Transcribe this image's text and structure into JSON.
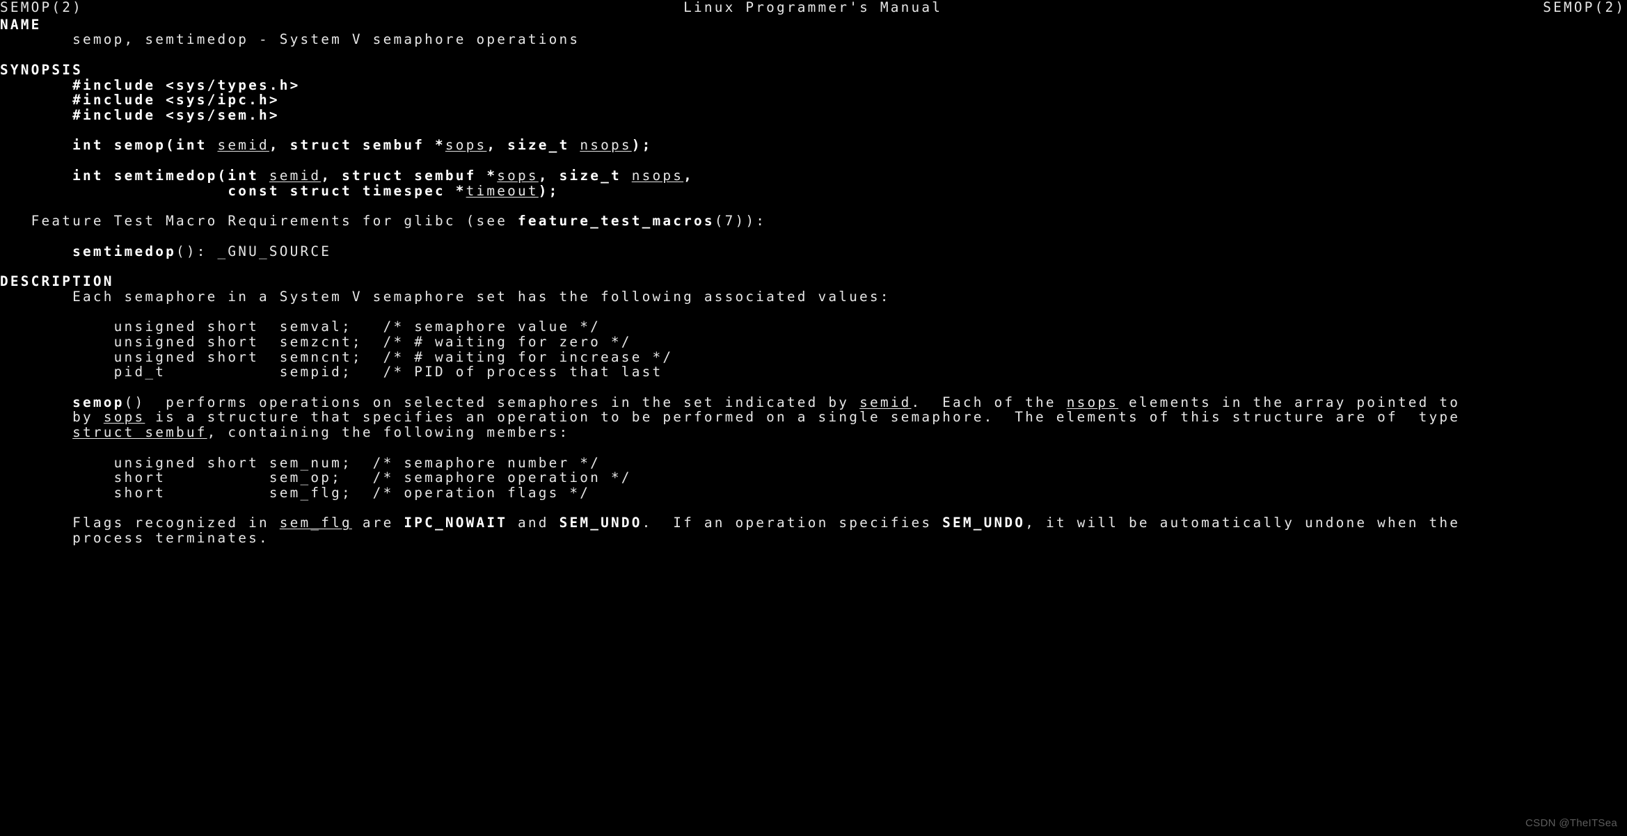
{
  "terminal": {
    "background_color": "#000000",
    "foreground_color": "#e6e6e6",
    "bold_color": "#ffffff"
  },
  "manpage": {
    "name": "SEMOP",
    "section": "2",
    "header_left": "SEMOP(2)",
    "header_center": "Linux Programmer's Manual",
    "header_right": "SEMOP(2)"
  },
  "lines": [
    {
      "id": "blank-1",
      "segments": []
    },
    {
      "id": "section-name",
      "segments": [
        {
          "t": "NAME",
          "s": "b"
        }
      ]
    },
    {
      "id": "name-body",
      "segments": [
        {
          "t": "       semop, semtimedop - System V semaphore operations",
          "s": ""
        }
      ]
    },
    {
      "id": "blank-2",
      "segments": []
    },
    {
      "id": "section-synopsis",
      "segments": [
        {
          "t": "SYNOPSIS",
          "s": "b"
        }
      ]
    },
    {
      "id": "include-types",
      "segments": [
        {
          "t": "       ",
          "s": ""
        },
        {
          "t": "#include <sys/types.h>",
          "s": "b"
        }
      ]
    },
    {
      "id": "include-ipc",
      "segments": [
        {
          "t": "       ",
          "s": ""
        },
        {
          "t": "#include <sys/ipc.h>",
          "s": "b"
        }
      ]
    },
    {
      "id": "include-sem",
      "segments": [
        {
          "t": "       ",
          "s": ""
        },
        {
          "t": "#include <sys/sem.h>",
          "s": "b"
        }
      ]
    },
    {
      "id": "blank-3",
      "segments": []
    },
    {
      "id": "proto-semop",
      "segments": [
        {
          "t": "       ",
          "s": ""
        },
        {
          "t": "int semop(int ",
          "s": "b"
        },
        {
          "t": "semid",
          "s": "u"
        },
        {
          "t": ", struct sembuf *",
          "s": "b"
        },
        {
          "t": "sops",
          "s": "u"
        },
        {
          "t": ", size_t ",
          "s": "b"
        },
        {
          "t": "nsops",
          "s": "u"
        },
        {
          "t": ");",
          "s": "b"
        }
      ]
    },
    {
      "id": "blank-4",
      "segments": []
    },
    {
      "id": "proto-semtimedop-1",
      "segments": [
        {
          "t": "       ",
          "s": ""
        },
        {
          "t": "int semtimedop(int ",
          "s": "b"
        },
        {
          "t": "semid",
          "s": "u"
        },
        {
          "t": ", struct sembuf *",
          "s": "b"
        },
        {
          "t": "sops",
          "s": "u"
        },
        {
          "t": ", size_t ",
          "s": "b"
        },
        {
          "t": "nsops",
          "s": "u"
        },
        {
          "t": ",",
          "s": "b"
        }
      ]
    },
    {
      "id": "proto-semtimedop-2",
      "segments": [
        {
          "t": "                      ",
          "s": ""
        },
        {
          "t": "const struct timespec *",
          "s": "b"
        },
        {
          "t": "timeout",
          "s": "u"
        },
        {
          "t": ");",
          "s": "b"
        }
      ]
    },
    {
      "id": "blank-5",
      "segments": []
    },
    {
      "id": "feature-test-heading",
      "segments": [
        {
          "t": "   Feature Test Macro Requirements for glibc (see ",
          "s": ""
        },
        {
          "t": "feature_test_macros",
          "s": "b"
        },
        {
          "t": "(7)):",
          "s": ""
        }
      ]
    },
    {
      "id": "blank-6",
      "segments": []
    },
    {
      "id": "feature-test-semtimedop",
      "segments": [
        {
          "t": "       ",
          "s": ""
        },
        {
          "t": "semtimedop",
          "s": "b"
        },
        {
          "t": "(): _GNU_SOURCE",
          "s": ""
        }
      ]
    },
    {
      "id": "blank-7",
      "segments": []
    },
    {
      "id": "section-description",
      "segments": [
        {
          "t": "DESCRIPTION",
          "s": "b"
        }
      ]
    },
    {
      "id": "desc-intro",
      "segments": [
        {
          "t": "       Each semaphore in a System V semaphore set has the following associated values:",
          "s": ""
        }
      ]
    },
    {
      "id": "blank-8",
      "segments": []
    },
    {
      "id": "semval-line",
      "segments": [
        {
          "t": "           unsigned short  semval;   /* semaphore value */",
          "s": ""
        }
      ]
    },
    {
      "id": "semzcnt-line",
      "segments": [
        {
          "t": "           unsigned short  semzcnt;  /* # waiting for zero */",
          "s": ""
        }
      ]
    },
    {
      "id": "semncnt-line",
      "segments": [
        {
          "t": "           unsigned short  semncnt;  /* # waiting for increase */",
          "s": ""
        }
      ]
    },
    {
      "id": "sempid-line",
      "segments": [
        {
          "t": "           pid_t           sempid;   /* PID of process that last",
          "s": ""
        }
      ]
    },
    {
      "id": "blank-9",
      "segments": []
    },
    {
      "id": "semop-desc-1",
      "segments": [
        {
          "t": "       ",
          "s": ""
        },
        {
          "t": "semop",
          "s": "b"
        },
        {
          "t": "()  performs operations on selected semaphores in the set indicated by ",
          "s": ""
        },
        {
          "t": "semid",
          "s": "u"
        },
        {
          "t": ".  Each of the ",
          "s": ""
        },
        {
          "t": "nsops",
          "s": "u"
        },
        {
          "t": " elements in the array pointed to",
          "s": ""
        }
      ]
    },
    {
      "id": "semop-desc-2",
      "segments": [
        {
          "t": "       by ",
          "s": ""
        },
        {
          "t": "sops",
          "s": "u"
        },
        {
          "t": " is a structure that specifies an operation to be performed on a single semaphore.  The elements of this structure are of  type",
          "s": ""
        }
      ]
    },
    {
      "id": "semop-desc-3",
      "segments": [
        {
          "t": "       ",
          "s": ""
        },
        {
          "t": "struct sembuf",
          "s": "u"
        },
        {
          "t": ", containing the following members:",
          "s": ""
        }
      ]
    },
    {
      "id": "blank-10",
      "segments": []
    },
    {
      "id": "sem-num-line",
      "segments": [
        {
          "t": "           unsigned short sem_num;  /* semaphore number */",
          "s": ""
        }
      ]
    },
    {
      "id": "sem-op-line",
      "segments": [
        {
          "t": "           short          sem_op;   /* semaphore operation */",
          "s": ""
        }
      ]
    },
    {
      "id": "sem-flg-line",
      "segments": [
        {
          "t": "           short          sem_flg;  /* operation flags */",
          "s": ""
        }
      ]
    },
    {
      "id": "blank-11",
      "segments": []
    },
    {
      "id": "flags-desc-1",
      "segments": [
        {
          "t": "       Flags recognized in ",
          "s": ""
        },
        {
          "t": "sem_flg",
          "s": "u"
        },
        {
          "t": " are ",
          "s": ""
        },
        {
          "t": "IPC_NOWAIT",
          "s": "b"
        },
        {
          "t": " and ",
          "s": ""
        },
        {
          "t": "SEM_UNDO",
          "s": "b"
        },
        {
          "t": ".  If an operation specifies ",
          "s": ""
        },
        {
          "t": "SEM_UNDO",
          "s": "b"
        },
        {
          "t": ", it will be automatically undone when the",
          "s": ""
        }
      ]
    },
    {
      "id": "flags-desc-2",
      "segments": [
        {
          "t": "       process terminates.",
          "s": ""
        }
      ]
    }
  ],
  "watermark": {
    "text": "CSDN @TheITSea"
  }
}
